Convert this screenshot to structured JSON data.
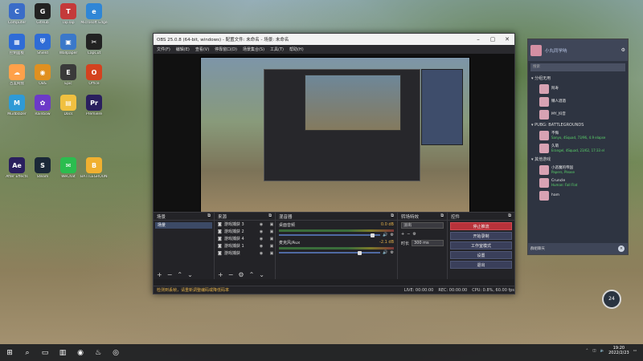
{
  "desktop_icons": [
    {
      "label": "Computer",
      "color": "#3a6cc8",
      "glyph": "C"
    },
    {
      "label": "GitHub",
      "color": "#222222",
      "glyph": "G"
    },
    {
      "label": "TapTap",
      "color": "#c43a3a",
      "glyph": "T"
    },
    {
      "label": "Microsoft Edge",
      "color": "#2f86d6",
      "glyph": "e"
    },
    {
      "label": "控制面板",
      "color": "#2f6cd6",
      "glyph": "▦"
    },
    {
      "label": "Shield",
      "color": "#2f6cd6",
      "glyph": "⛨"
    },
    {
      "label": "Wallpaper",
      "color": "#3b78c9",
      "glyph": "▣"
    },
    {
      "label": "CapCut",
      "color": "#222222",
      "glyph": "✂"
    },
    {
      "label": "百度网盘",
      "color": "#ffa14a",
      "glyph": "☁"
    },
    {
      "label": "OBS",
      "color": "#e09020",
      "glyph": "◉"
    },
    {
      "label": "Epic",
      "color": "#3a3a3a",
      "glyph": "E"
    },
    {
      "label": "Office",
      "color": "#d4421f",
      "glyph": "O"
    },
    {
      "label": "Mudblazer",
      "color": "#2f9ad6",
      "glyph": "M"
    },
    {
      "label": "Rainbow",
      "color": "#6c3ac8",
      "glyph": "✿"
    },
    {
      "label": "Docs",
      "color": "#f0c040",
      "glyph": "▤"
    },
    {
      "label": "Premiere",
      "color": "#2a1f5e",
      "glyph": "Pr"
    },
    {
      "label": "After Effects",
      "color": "#2a1f5e",
      "glyph": "Ae"
    },
    {
      "label": "Steam",
      "color": "#1b2838",
      "glyph": "S"
    },
    {
      "label": "WeChat",
      "color": "#2bbd4f",
      "glyph": "✉"
    },
    {
      "label": "BATTLEGROUNDS",
      "color": "#f0b030",
      "glyph": "B"
    }
  ],
  "obs": {
    "title": "OBS 25.0.8 (64-bit, windows) - 配置文件: 未命名 - 场景: 未命名",
    "menu": [
      "文件(F)",
      "编辑(E)",
      "查看(V)",
      "停靠窗口(D)",
      "场景集合(S)",
      "工具(T)",
      "帮助(H)"
    ],
    "scenes": {
      "title": "场景",
      "items": [
        "场景"
      ]
    },
    "sources": {
      "title": "来源",
      "items": [
        "游戏捕获 3",
        "游戏捕获 2",
        "游戏捕获 4",
        "游戏捕获 1",
        "游戏捕获"
      ]
    },
    "mixer": {
      "title": "混音器",
      "channels": [
        {
          "name": "桌面音频",
          "db": "0.0 dB",
          "fill": 0.93
        },
        {
          "name": "麦克风/Aux",
          "db": "-2.1 dB",
          "fill": 0.8
        }
      ]
    },
    "transitions": {
      "title": "转场特效",
      "selected": "淡出",
      "duration_label": "时长",
      "duration": "300 ms"
    },
    "controls": {
      "title": "控件",
      "buttons": [
        "停止推流",
        "开始录制",
        "工作室模式",
        "设置",
        "退出"
      ]
    },
    "status": {
      "message": "检测到丢帧，请重新调整编码或降低码率",
      "live": "LIVE: 00:00:00",
      "rec": "REC: 00:00:00",
      "cpu": "CPU: 0.8%, 60.00 fps"
    }
  },
  "chat": {
    "username": "小丸同学呐",
    "search_placeholder": "搜索",
    "groups": [
      {
        "name": "分组无用",
        "friends": [
          {
            "name": "阿寿",
            "status": ""
          },
          {
            "name": "懒人酒酒",
            "status": ""
          },
          {
            "name": "MY_抖音",
            "status": ""
          }
        ]
      },
      {
        "name": "PUBG: BATTLEGROUNDS",
        "friends": [
          {
            "name": "不悔",
            "status": "Sanyo, 4Squad, 73/96, 4.9 elapse"
          },
          {
            "name": "久萌",
            "status": "Erangel, 4Squad, 23/62, 17:33 el"
          }
        ]
      },
      {
        "name": "其他游戏",
        "friends": [
          {
            "name": "小恶魔的帝国",
            "status": "Papers, Please"
          },
          {
            "name": "Cruncle",
            "status": "Human: Fall Flat"
          },
          {
            "name": "ham",
            "status": ""
          }
        ]
      }
    ],
    "footer_label": "群组聊天"
  },
  "taskbar": {
    "icons": [
      "⊞",
      "⌕",
      "▭",
      "▥",
      "◉",
      "♨",
      "◎"
    ],
    "time": "19:20",
    "date": "2022/2/23",
    "perf": "24"
  }
}
